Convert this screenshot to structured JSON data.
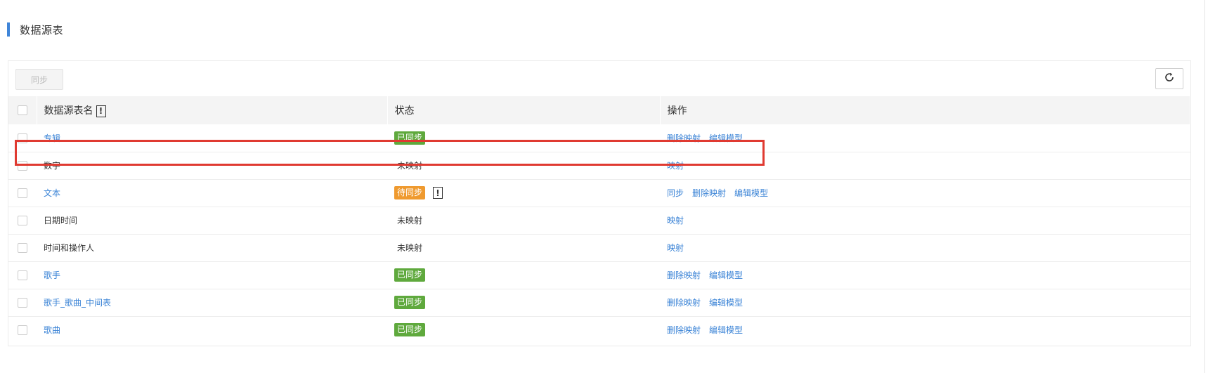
{
  "section": {
    "title": "数据源表"
  },
  "toolbar": {
    "sync_label": "同步",
    "refresh_icon": "refresh-icon"
  },
  "table": {
    "headers": {
      "name": "数据源表名",
      "status": "状态",
      "actions": "操作",
      "info_mark": "!"
    },
    "rows": [
      {
        "name": "专辑",
        "name_is_link": true,
        "status": "已同步",
        "status_type": "synced",
        "actions": [
          "删除映射",
          "编辑模型"
        ]
      },
      {
        "name": "数字",
        "name_is_link": false,
        "status": "未映射",
        "status_type": "unmapped",
        "actions": [
          "映射"
        ]
      },
      {
        "name": "文本",
        "name_is_link": true,
        "status": "待同步",
        "status_type": "pending",
        "status_info": "!",
        "actions": [
          "同步",
          "删除映射",
          "编辑模型"
        ]
      },
      {
        "name": "日期时间",
        "name_is_link": false,
        "status": "未映射",
        "status_type": "unmapped",
        "actions": [
          "映射"
        ]
      },
      {
        "name": "时间和操作人",
        "name_is_link": false,
        "status": "未映射",
        "status_type": "unmapped",
        "actions": [
          "映射"
        ]
      },
      {
        "name": "歌手",
        "name_is_link": true,
        "status": "已同步",
        "status_type": "synced",
        "actions": [
          "删除映射",
          "编辑模型"
        ]
      },
      {
        "name": "歌手_歌曲_中间表",
        "name_is_link": true,
        "status": "已同步",
        "status_type": "synced",
        "actions": [
          "删除映射",
          "编辑模型"
        ]
      },
      {
        "name": "歌曲",
        "name_is_link": true,
        "status": "已同步",
        "status_type": "synced",
        "actions": [
          "删除映射",
          "编辑模型"
        ]
      }
    ]
  },
  "colors": {
    "accent": "#3f85d8",
    "link": "#3a83d6",
    "synced": "#5fa93d",
    "pending": "#ef9a2f",
    "highlight": "#e03a31"
  }
}
